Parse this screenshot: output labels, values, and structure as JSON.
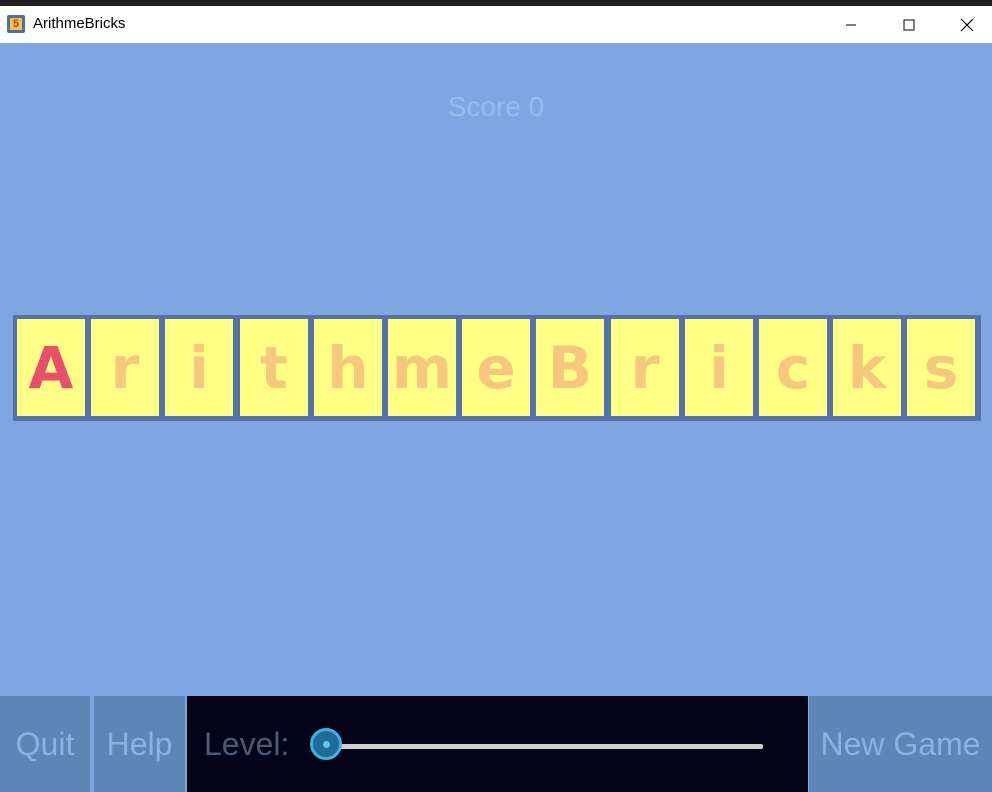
{
  "window": {
    "title": "ArithmeBricks",
    "icon": "app-icon",
    "icon_glyph": "5"
  },
  "game": {
    "score_text": "Score 0",
    "bricks": [
      "A",
      "r",
      "i",
      "t",
      "h",
      "m",
      "e",
      "B",
      "r",
      "i",
      "c",
      "k",
      "s"
    ],
    "active_index": 0
  },
  "controls": {
    "quit_label": "Quit",
    "help_label": "Help",
    "level_label": "Level:",
    "level_fraction": 0,
    "new_game_label": "New Game"
  },
  "colors": {
    "background": "#7da6e3",
    "brick_fill": "#fffe85",
    "brick_letter": "#f7c77d",
    "active_letter": "#e94e6b",
    "slider_accent": "#39b4e5"
  }
}
